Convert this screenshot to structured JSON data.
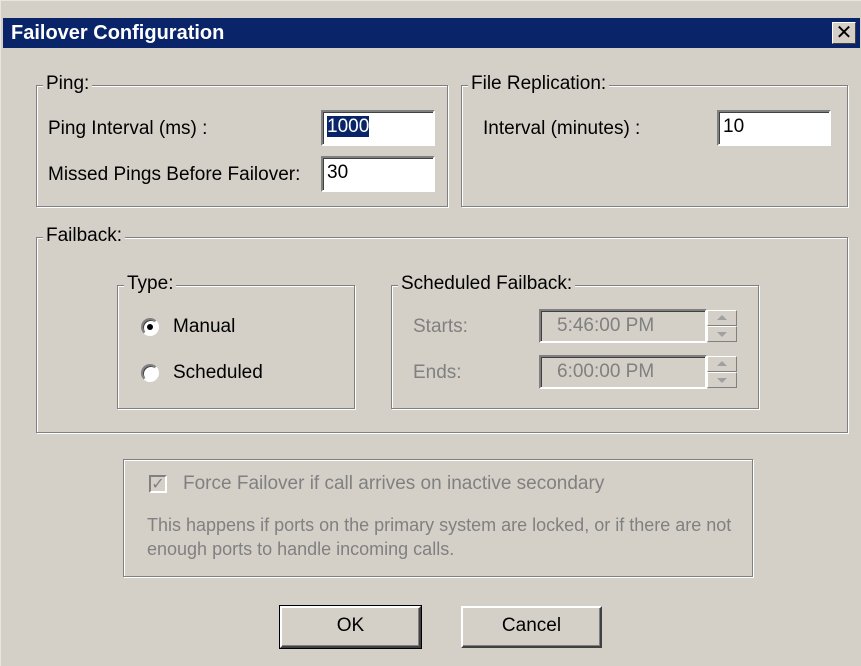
{
  "window": {
    "title": "Failover Configuration",
    "close_glyph": "✕"
  },
  "ping": {
    "legend": "Ping:",
    "interval_label": "Ping Interval (ms) :",
    "interval_value": "1000",
    "missed_label": "Missed Pings Before Failover:",
    "missed_value": "30"
  },
  "file_replication": {
    "legend": "File Replication:",
    "interval_label": "Interval (minutes) :",
    "interval_value": "10"
  },
  "failback": {
    "legend": "Failback:",
    "type": {
      "legend": "Type:",
      "options": [
        {
          "label": "Manual",
          "checked": true
        },
        {
          "label": "Scheduled",
          "checked": false
        }
      ]
    },
    "scheduled": {
      "legend": "Scheduled Failback:",
      "starts_label": "Starts:",
      "starts_value": "5:46:00 PM",
      "ends_label": "Ends:",
      "ends_value": "6:00:00 PM"
    }
  },
  "force_failover": {
    "label": "Force Failover if call arrives on inactive secondary",
    "checked": true,
    "description": "This happens if ports on the primary system are locked, or if there are not enough ports to handle incoming calls."
  },
  "buttons": {
    "ok": "OK",
    "cancel": "Cancel"
  }
}
